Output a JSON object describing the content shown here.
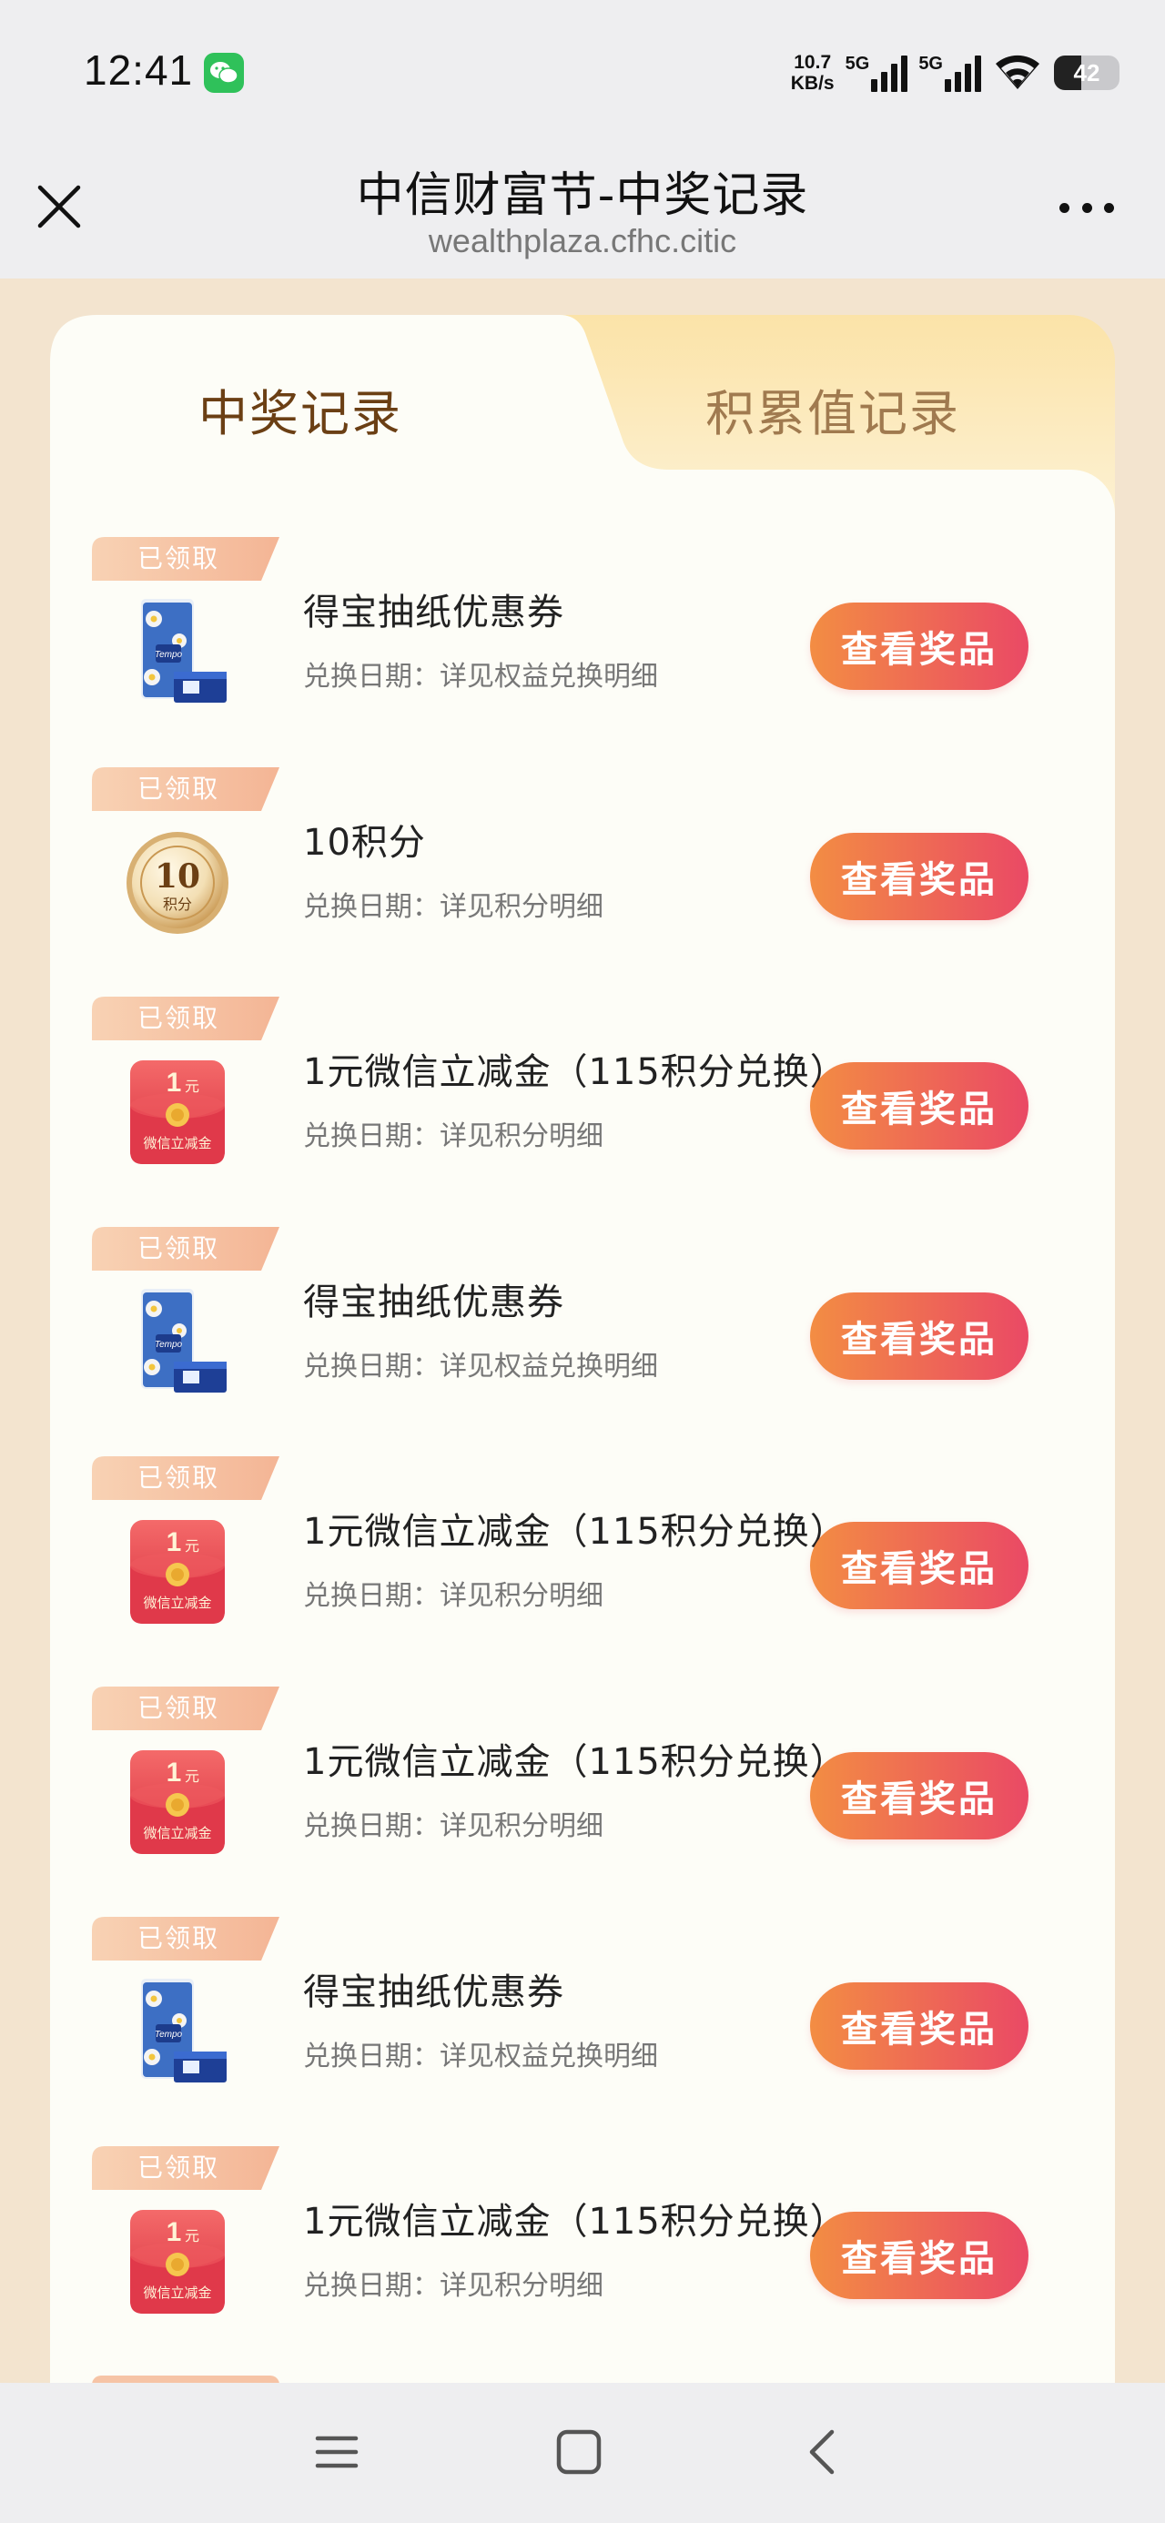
{
  "status_bar": {
    "time": "12:41",
    "speed_value": "10.7",
    "speed_unit": "KB/s",
    "net1": "5G",
    "net2": "5G",
    "battery": "42"
  },
  "header": {
    "title": "中信财富节-中奖记录",
    "subtitle": "wealthplaza.cfhc.citic"
  },
  "tabs": [
    {
      "label": "中奖记录",
      "active": true
    },
    {
      "label": "积累值记录",
      "active": false
    }
  ],
  "records": [
    {
      "status": "已领取",
      "name": "得宝抽纸优惠券",
      "date": "兑换日期：详见权益兑换明细",
      "button": "查看奖品",
      "icon": "tissue-box-icon"
    },
    {
      "status": "已领取",
      "name": "10积分",
      "date": "兑换日期：详见积分明细",
      "button": "查看奖品",
      "icon": "points-coin-icon",
      "coin_value": "10",
      "coin_label": "积分"
    },
    {
      "status": "已领取",
      "name": "1元微信立减金（115积分兑换）",
      "date": "兑换日期：详见积分明细",
      "button": "查看奖品",
      "icon": "red-envelope-icon",
      "amount": "1",
      "amount_unit": "元",
      "envelope_label": "微信立减金"
    },
    {
      "status": "已领取",
      "name": "得宝抽纸优惠券",
      "date": "兑换日期：详见权益兑换明细",
      "button": "查看奖品",
      "icon": "tissue-box-icon"
    },
    {
      "status": "已领取",
      "name": "1元微信立减金（115积分兑换）",
      "date": "兑换日期：详见积分明细",
      "button": "查看奖品",
      "icon": "red-envelope-icon",
      "amount": "1",
      "amount_unit": "元",
      "envelope_label": "微信立减金"
    },
    {
      "status": "已领取",
      "name": "1元微信立减金（115积分兑换）",
      "date": "兑换日期：详见积分明细",
      "button": "查看奖品",
      "icon": "red-envelope-icon",
      "amount": "1",
      "amount_unit": "元",
      "envelope_label": "微信立减金"
    },
    {
      "status": "已领取",
      "name": "得宝抽纸优惠券",
      "date": "兑换日期：详见权益兑换明细",
      "button": "查看奖品",
      "icon": "tissue-box-icon"
    },
    {
      "status": "已领取",
      "name": "1元微信立减金（115积分兑换）",
      "date": "兑换日期：详见积分明细",
      "button": "查看奖品",
      "icon": "red-envelope-icon",
      "amount": "1",
      "amount_unit": "元",
      "envelope_label": "微信立减金"
    }
  ],
  "tissue_brand": "Tempo",
  "colors": {
    "accent_gradient_start": "#f38d43",
    "accent_gradient_end": "#ea4965",
    "active_tab_text": "#6b3f14",
    "ribbon": "#f6c4a6",
    "page_bg": "#f3e4cf"
  },
  "nav": {
    "menu_icon": "menu-icon",
    "home_icon": "home-square-icon",
    "back_icon": "back-chevron-icon"
  }
}
